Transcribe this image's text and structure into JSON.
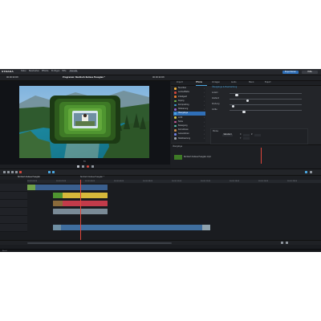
{
  "app": {
    "logo": "STRADA",
    "menu": [
      "Datei",
      "Bearbeiten",
      "Effekte",
      "Einfügen",
      "Hilfe",
      "Dienste"
    ],
    "right_buttons": [
      "Exportieren",
      "Hilfe"
    ],
    "project_title": "Programm: Nordisch Kulisse Fussglan *",
    "timecode_left": "00:00:02:08",
    "timecode_right": "00:00:02:08",
    "zoom_label": "Fit"
  },
  "panel": {
    "tabs": [
      "Import",
      "Effekte",
      "Vorlagen",
      "Audio",
      "Menü",
      "Export"
    ],
    "active_tab": "Effekte",
    "section_title": "Übergänge & Bearbeitung",
    "effects": [
      {
        "label": "Favoriten",
        "color": "#f0b23c"
      },
      {
        "label": "Audioeffekte",
        "color": "#d2463c"
      },
      {
        "label": "Intelligent",
        "color": "#e2782c"
      },
      {
        "label": "Keying",
        "color": "#6fb84a"
      },
      {
        "label": "Kompositing",
        "color": "#3c9fd2"
      },
      {
        "label": "Stilisierung",
        "color": "#8f62c9"
      },
      {
        "label": "Übergänge",
        "color": "#4aa6e0",
        "selected": true
      },
      {
        "label": "Licht",
        "color": "#d1c34a"
      },
      {
        "label": "Farbe",
        "color": "#c65b9a"
      },
      {
        "label": "Bewegung",
        "color": "#5bc6b0"
      },
      {
        "label": "Korrekturen",
        "color": "#c98c4a"
      },
      {
        "label": "Generatoren",
        "color": "#6d7fe0"
      },
      {
        "label": "Stabilisierung",
        "color": "#9ca3ad"
      }
    ],
    "params": [
      {
        "label": "Anzahl",
        "knob": 0.1,
        "value": ""
      },
      {
        "label": "Abstand",
        "knob": 0.25,
        "value": ""
      },
      {
        "label": "Drehung",
        "knob": 0.05,
        "value": ""
      },
      {
        "label": "Größe",
        "knob": 0.2,
        "value": ""
      }
    ],
    "mode_label": "Modus",
    "mode_value": "Standard",
    "coords": [
      "X",
      "Y",
      "Z"
    ]
  },
  "media": {
    "clip_label": "Nordisch Kulisse Fussglan.mp4",
    "tab": "Übergänge"
  },
  "timeline": {
    "tabs": [
      "Nordisch Kulisse Fussglan",
      "Nordisch Kulisse Fussglan *"
    ],
    "marker_label": "00:00:02:08",
    "ruler": [
      "00:00:00:00",
      "00:00:02:00",
      "00:00:04:00",
      "00:00:06:00",
      "00:00:08:00",
      "00:00:10:00",
      "00:00:12:00",
      "00:00:14:00",
      "00:00:16:00",
      "00:00:18:00"
    ],
    "status": "Bereit"
  }
}
